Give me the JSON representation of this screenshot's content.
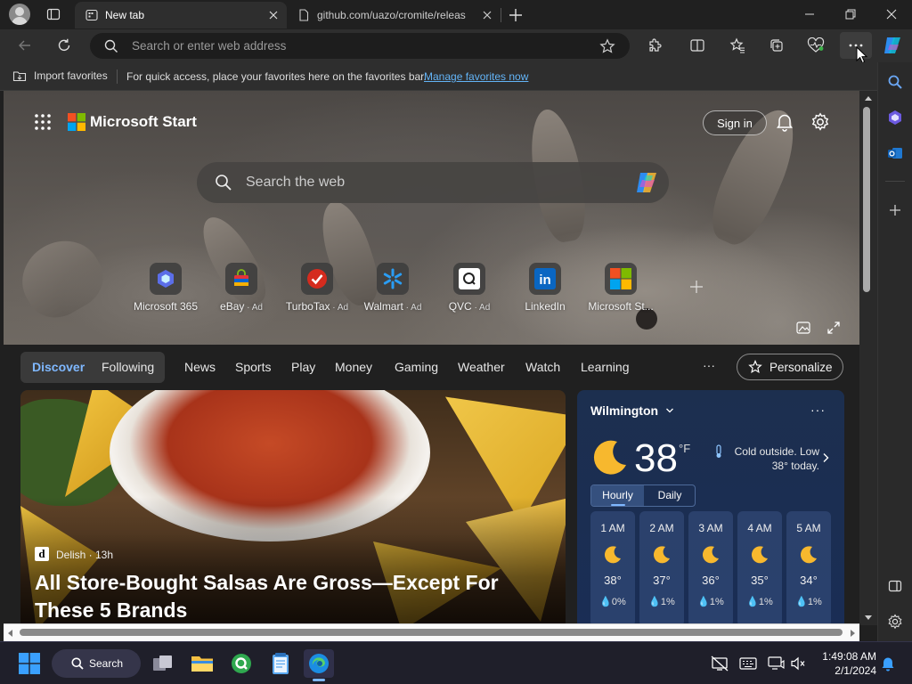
{
  "tabs": [
    {
      "title": "New tab",
      "active": true
    },
    {
      "title": "github.com/uazo/cromite/releas",
      "active": false
    }
  ],
  "omnibox": {
    "placeholder": "Search or enter web address"
  },
  "favorites_bar": {
    "import_label": "Import favorites",
    "hint": "For quick access, place your favorites here on the favorites bar.",
    "manage_link": "Manage favorites now"
  },
  "start": {
    "brand": "Microsoft Start",
    "sign_in": "Sign in",
    "search_placeholder": "Search the web",
    "quick_links": [
      {
        "label": "Microsoft 365",
        "ad": ""
      },
      {
        "label": "eBay",
        "ad": " · Ad"
      },
      {
        "label": "TurboTax",
        "ad": " · Ad"
      },
      {
        "label": "Walmart",
        "ad": " · Ad"
      },
      {
        "label": "QVC",
        "ad": " · Ad"
      },
      {
        "label": "LinkedIn",
        "ad": ""
      },
      {
        "label": "Microsoft St...",
        "ad": ""
      }
    ]
  },
  "feed_nav": {
    "items": [
      "Discover",
      "Following",
      "News",
      "Sports",
      "Play",
      "Money",
      "Gaming",
      "Weather",
      "Watch",
      "Learning"
    ],
    "more": "···",
    "personalize": "Personalize"
  },
  "hero": {
    "source": "Delish",
    "age": "13h",
    "source_line": "Delish · 13h",
    "headline": "All Store-Bought Salsas Are Gross—Except For These 5 Brands"
  },
  "weather": {
    "city": "Wilmington",
    "temp": "38",
    "unit": "°F",
    "summary": "Cold outside. Low 38° today.",
    "tabs": [
      "Hourly",
      "Daily"
    ],
    "hours": [
      {
        "time": "1 AM",
        "temp": "38°",
        "precip": "0%"
      },
      {
        "time": "2 AM",
        "temp": "37°",
        "precip": "1%"
      },
      {
        "time": "3 AM",
        "temp": "36°",
        "precip": "1%"
      },
      {
        "time": "4 AM",
        "temp": "35°",
        "precip": "1%"
      },
      {
        "time": "5 AM",
        "temp": "34°",
        "precip": "1%"
      }
    ]
  },
  "taskbar": {
    "search_label": "Search",
    "time": "1:49:08 AM",
    "date": "2/1/2024"
  },
  "colors": {
    "accent": "#63b4f7",
    "titlebar": "#202020",
    "toolbar": "#2e2e2e"
  }
}
